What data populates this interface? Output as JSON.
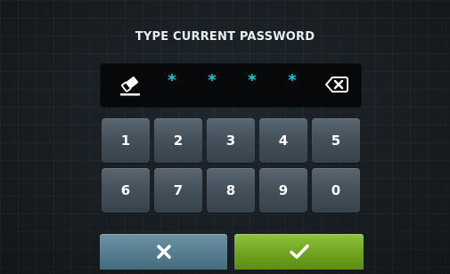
{
  "title": "TYPE CURRENT PASSWORD",
  "password": {
    "mask_chars": [
      "*",
      "*",
      "*",
      "*"
    ],
    "mask_color": "#22c9cf",
    "clear_icon": "eraser-icon",
    "backspace_icon": "backspace-icon"
  },
  "keypad": {
    "row1": [
      "1",
      "2",
      "3",
      "4",
      "5"
    ],
    "row2": [
      "6",
      "7",
      "8",
      "9",
      "0"
    ]
  },
  "actions": {
    "cancel_icon": "close-icon",
    "confirm_icon": "checkmark-icon"
  },
  "colors": {
    "background": "#1b2024",
    "key": "#45515a",
    "cancel": "#557d90",
    "confirm": "#6fa320"
  }
}
